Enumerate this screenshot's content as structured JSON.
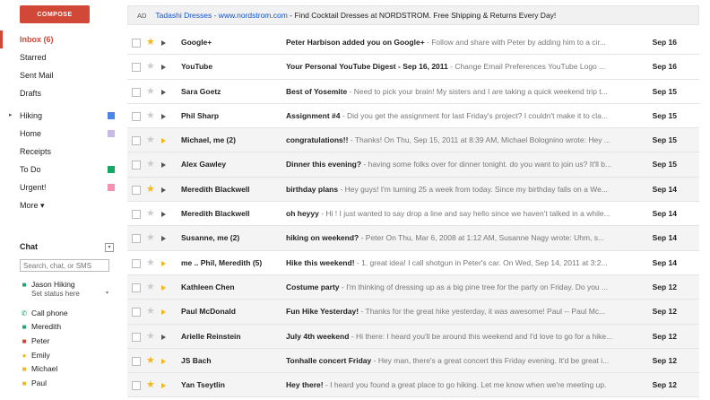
{
  "sidebar": {
    "compose": "COMPOSE",
    "nav": [
      {
        "label": "Inbox (6)",
        "active": true,
        "arrow": "",
        "color": ""
      },
      {
        "label": "Starred",
        "active": false,
        "arrow": "",
        "color": ""
      },
      {
        "label": "Sent Mail",
        "active": false,
        "arrow": "",
        "color": ""
      },
      {
        "label": "Drafts",
        "active": false,
        "arrow": "",
        "color": ""
      },
      {
        "label": "Hiking",
        "active": false,
        "arrow": "▸",
        "color": "#4a86e8"
      },
      {
        "label": "Home",
        "active": false,
        "arrow": "",
        "color": "#c9b8e8"
      },
      {
        "label": "Receipts",
        "active": false,
        "arrow": "",
        "color": ""
      },
      {
        "label": "To Do",
        "active": false,
        "arrow": "",
        "color": "#16a765"
      },
      {
        "label": "Urgent!",
        "active": false,
        "arrow": "",
        "color": "#f691b2"
      },
      {
        "label": "More ▾",
        "active": false,
        "arrow": "",
        "color": ""
      }
    ]
  },
  "chat": {
    "header": "Chat",
    "search_placeholder": "Search, chat, or SMS",
    "status_text": "Set status here",
    "contacts": [
      {
        "name": "Jason Hiking",
        "icon": "video-icon",
        "glyph": "■",
        "color": "#16a765"
      },
      {
        "name": "Call phone",
        "icon": "phone-icon",
        "glyph": "✆",
        "color": "#16a765"
      },
      {
        "name": "Meredith",
        "icon": "video-icon",
        "glyph": "■",
        "color": "#16a765"
      },
      {
        "name": "Peter",
        "icon": "video-icon",
        "glyph": "■",
        "color": "#e0392b"
      },
      {
        "name": "Emily",
        "icon": "status-dot-icon",
        "glyph": "●",
        "color": "#f3b71b"
      },
      {
        "name": "Michael",
        "icon": "video-icon",
        "glyph": "■",
        "color": "#f3b71b"
      },
      {
        "name": "Paul",
        "icon": "video-icon",
        "glyph": "■",
        "color": "#f3b71b"
      }
    ]
  },
  "ad": {
    "tag": "AD",
    "link": "Tadashi Dresses - www.nordstrom.com",
    "text": " - Find Cocktail Dresses at NORDSTROM. Free Shipping & Returns Every Day!"
  },
  "emails": [
    {
      "sender": "Google+",
      "subject": "Peter Harbison added you on Google+",
      "snippet": " - Follow and share with Peter by adding him to a cir...",
      "date": "Sep 16",
      "starred": true,
      "important": false,
      "read": false
    },
    {
      "sender": "YouTube",
      "subject": "Your Personal YouTube Digest - Sep 16, 2011",
      "snippet": " - Change Email Preferences YouTube Logo ...",
      "date": "Sep 16",
      "starred": false,
      "important": false,
      "read": false
    },
    {
      "sender": "Sara Goetz",
      "subject": "Best of Yosemite",
      "snippet": " - Need to pick your brain! My sisters and I are taking a quick weekend trip t...",
      "date": "Sep 15",
      "starred": false,
      "important": false,
      "read": false
    },
    {
      "sender": "Phil Sharp",
      "subject": "Assignment #4",
      "snippet": " - Did you get the assignment for last Friday's project? I couldn't make it to cla...",
      "date": "Sep 15",
      "starred": false,
      "important": false,
      "read": false
    },
    {
      "sender": "Michael, me (2)",
      "subject": "congratulations!!",
      "snippet": " - Thanks! On Thu, Sep 15, 2011 at 8:39 AM, Michael Bolognino wrote: Hey ...",
      "date": "Sep 15",
      "starred": false,
      "important": true,
      "read": true
    },
    {
      "sender": "Alex Gawley",
      "subject": "Dinner this evening?",
      "snippet": " - having some folks over for dinner tonight. do you want to join us? It'll b...",
      "date": "Sep 15",
      "starred": false,
      "important": false,
      "read": true
    },
    {
      "sender": "Meredith Blackwell",
      "subject": "birthday plans",
      "snippet": " - Hey guys! I'm turning 25 a week from today. Since my birthday falls on a We...",
      "date": "Sep 14",
      "starred": true,
      "important": false,
      "read": true
    },
    {
      "sender": "Meredith Blackwell",
      "subject": "oh heyyy",
      "snippet": " - Hi ! I just wanted to say drop a line and say hello since we haven't talked in a while...",
      "date": "Sep 14",
      "starred": false,
      "important": false,
      "read": false
    },
    {
      "sender": "Susanne, me (2)",
      "subject": "hiking on weekend?",
      "snippet": " - Peter On Thu, Mar 6, 2008 at 1:12 AM, Susanne Nagy wrote: Uhm, s...",
      "date": "Sep 14",
      "starred": false,
      "important": false,
      "read": true
    },
    {
      "sender": "me .. Phil, Meredith (5)",
      "subject": "Hike this weekend!",
      "snippet": " - 1. great idea! I call shotgun in Peter's car. On Wed, Sep 14, 2011 at 3:2...",
      "date": "Sep 14",
      "starred": false,
      "important": true,
      "read": false
    },
    {
      "sender": "Kathleen Chen",
      "subject": "Costume party",
      "snippet": " - I'm thinking of dressing up as a big pine tree for the party on Friday. Do you ...",
      "date": "Sep 12",
      "starred": false,
      "important": true,
      "read": true
    },
    {
      "sender": "Paul McDonald",
      "subject": "Fun Hike Yesterday!",
      "snippet": " - Thanks for the great hike yesterday, it was awesome! Paul -- Paul Mc...",
      "date": "Sep 12",
      "starred": false,
      "important": true,
      "read": true
    },
    {
      "sender": "Arielle Reinstein",
      "subject": "July 4th weekend",
      "snippet": " - Hi there: I heard you'll be around this weekend and I'd love to go for a hike...",
      "date": "Sep 12",
      "starred": false,
      "important": false,
      "read": true
    },
    {
      "sender": "JS Bach",
      "subject": "Tonhalle concert Friday",
      "snippet": " - Hey man, there's a great concert this Friday evening. It'd be great i...",
      "date": "Sep 12",
      "starred": true,
      "important": true,
      "read": true
    },
    {
      "sender": "Yan Tseytlin",
      "subject": "Hey there!",
      "snippet": " - I heard you found a great place to go hiking. Let me know when we're meeting up.",
      "date": "Sep 12",
      "starred": true,
      "important": true,
      "read": true
    }
  ]
}
